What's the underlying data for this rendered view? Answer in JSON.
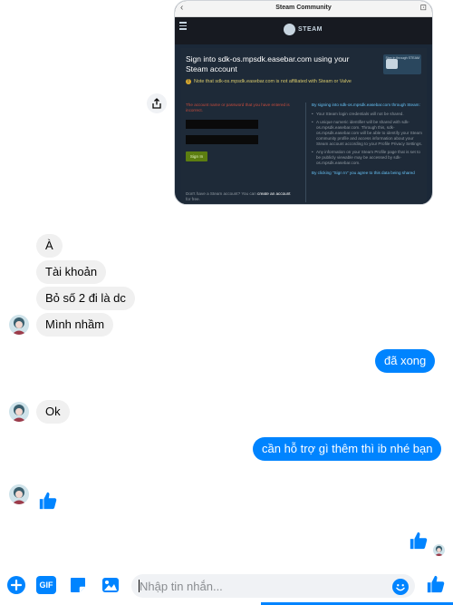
{
  "shared_image": {
    "window_title": "Steam Community",
    "back_glyph": "‹",
    "close_glyph": "⊡",
    "steam_logo_text": "STEAM",
    "sign_in_title": "Sign into sdk-os.mpsdk.easebar.com using your Steam account",
    "openid_badge": "Sign in through STEAM",
    "notice": "Note that sdk-os.mpsdk.easebar.com is not affiliated with Steam or Valve",
    "error_text": "The account name or password that you have entered is incorrect.",
    "sign_in_button": "Sign In",
    "no_account_text": "Don't have a Steam account? You can",
    "create_account_link": "create an account",
    "create_account_suffix": "for free.",
    "info_heading": "By signing into sdk-os.mpsdk.easebar.com through Steam:",
    "info_items": [
      "Your Steam login credentials will not be shared.",
      "A unique numeric identifier will be shared with sdk-os.mpsdk.easebar.com. Through this, sdk-os.mpsdk.easebar.com will be able to identify your Steam community profile and access information about your Steam account according to your Profile Privacy Settings.",
      "Any information on your Steam Profile page that is set to be publicly viewable may be accessed by sdk-os.mpsdk.easebar.com."
    ],
    "info_footer": "By clicking \"Sign In\" you agree to this data being shared"
  },
  "messages": {
    "incoming_1": "À",
    "incoming_2": "Tài khoản",
    "incoming_3": "Bỏ số 2 đi là dc",
    "incoming_4": "Mình nhầm",
    "outgoing_1": "đã xong",
    "incoming_5": "Ok",
    "outgoing_2": "cần hỗ trợ gì thêm thì ib nhé bạn"
  },
  "composer": {
    "placeholder": "Nhập tin nhắn...",
    "gif_label": "GIF"
  },
  "colors": {
    "accent": "#0084ff",
    "incoming_bubble": "#f0f0f0",
    "steam_bg": "#1b2838"
  }
}
